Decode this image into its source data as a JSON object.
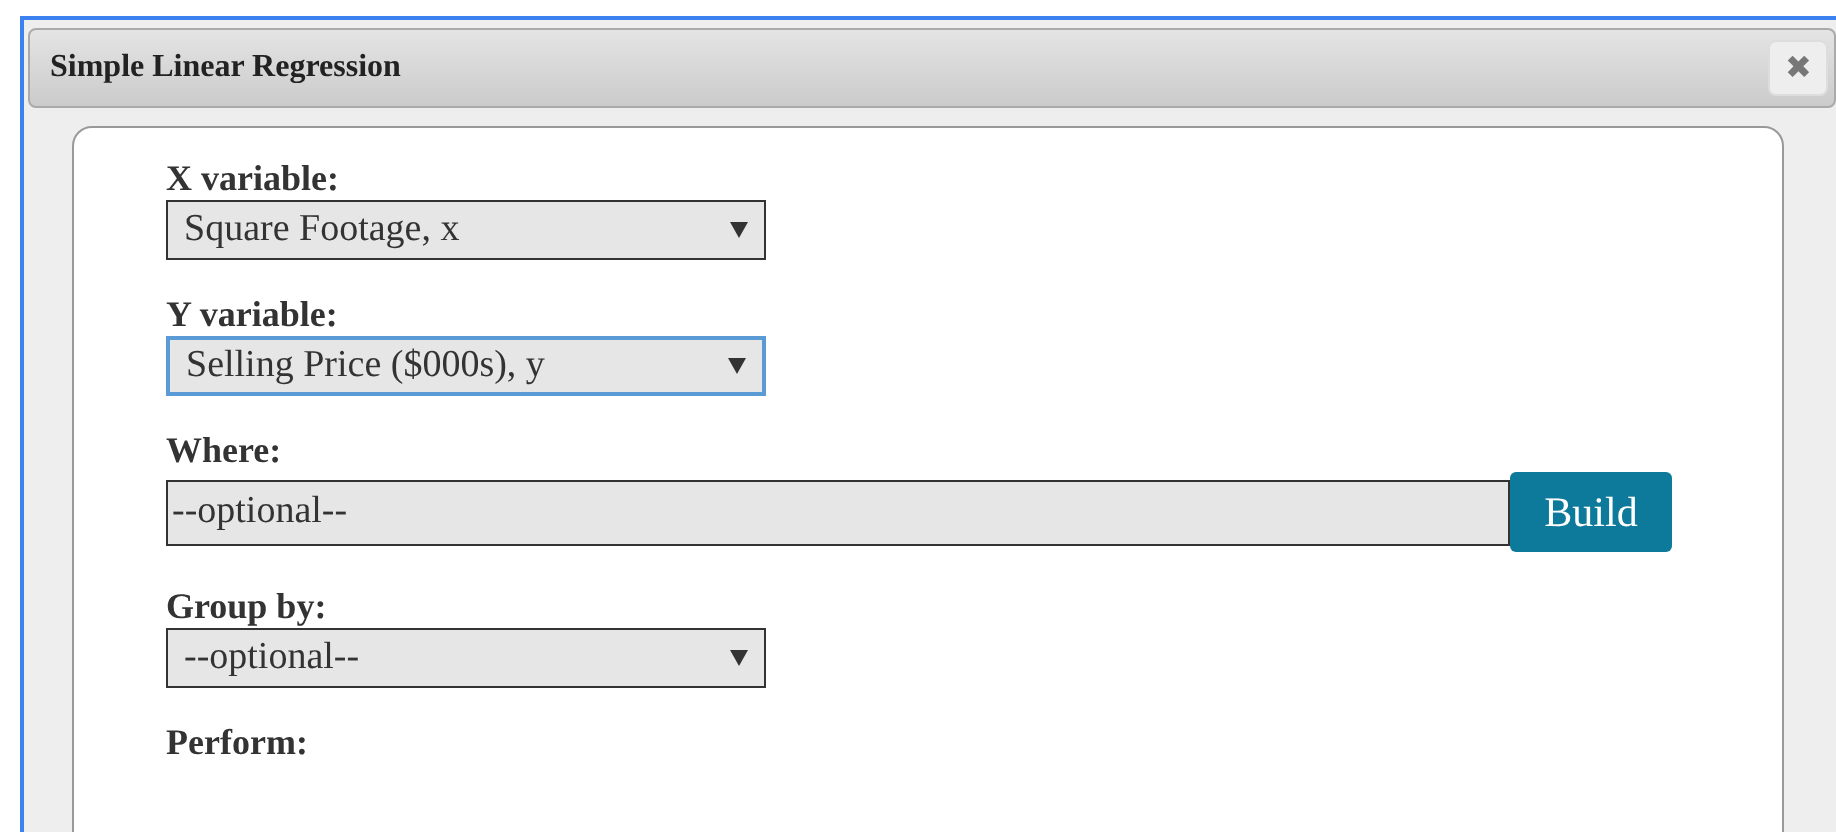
{
  "dialog": {
    "title": "Simple Linear Regression",
    "close": "✖"
  },
  "fields": [
    {
      "kind": "select",
      "label": "X variable:",
      "value": "Square Footage, x",
      "focused": false
    },
    {
      "kind": "select",
      "label": "Y variable:",
      "value": "Selling Price ($000s), y",
      "focused": true
    },
    {
      "kind": "text",
      "label": "Where:",
      "placeholder": "--optional--",
      "button": "Build"
    },
    {
      "kind": "select",
      "label": "Group by:",
      "value": "--optional--",
      "focused": false
    },
    {
      "kind": "heading",
      "label": "Perform:"
    }
  ]
}
